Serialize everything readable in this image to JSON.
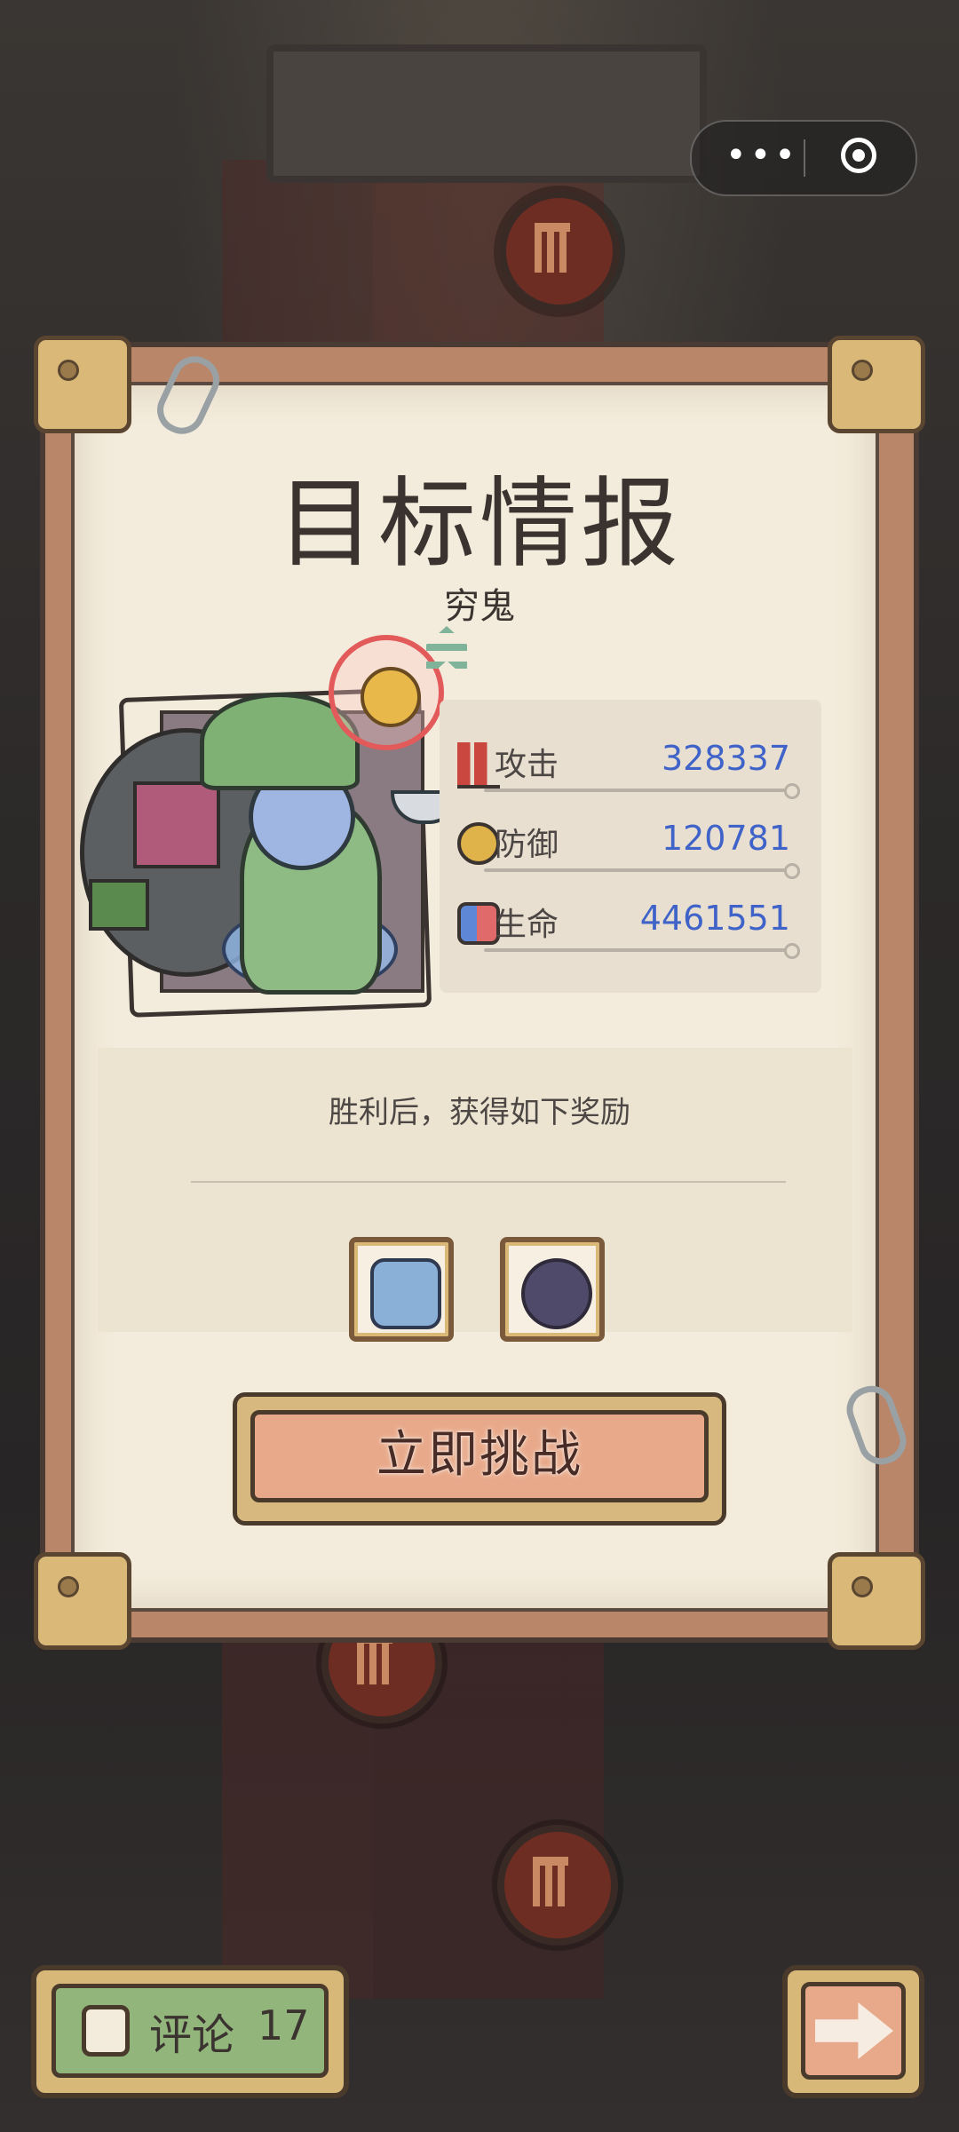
{
  "window": {
    "capsule_menu_icon": "more-dots-icon",
    "capsule_close_icon": "record-circle-icon"
  },
  "dialog": {
    "title": "目标情报",
    "enemy_name": "穷鬼",
    "stats": [
      {
        "label": "攻击",
        "value": "328337",
        "icon": "attack-icon"
      },
      {
        "label": "防御",
        "value": "120781",
        "icon": "defense-icon"
      },
      {
        "label": "生命",
        "value": "4461551",
        "icon": "health-icon"
      }
    ],
    "reward_caption": "胜利后，获得如下奖励",
    "rewards": [
      {
        "icon": "stone-fossil-icon"
      },
      {
        "icon": "dark-orb-icon"
      }
    ],
    "challenge_button": "立即挑战"
  },
  "footer": {
    "comment_label": "评论",
    "comment_count": "17",
    "next_icon": "arrow-right-icon"
  },
  "colors": {
    "stat_value": "#3f63c8",
    "challenge": "#e8a98a",
    "comment": "#92b57c"
  }
}
